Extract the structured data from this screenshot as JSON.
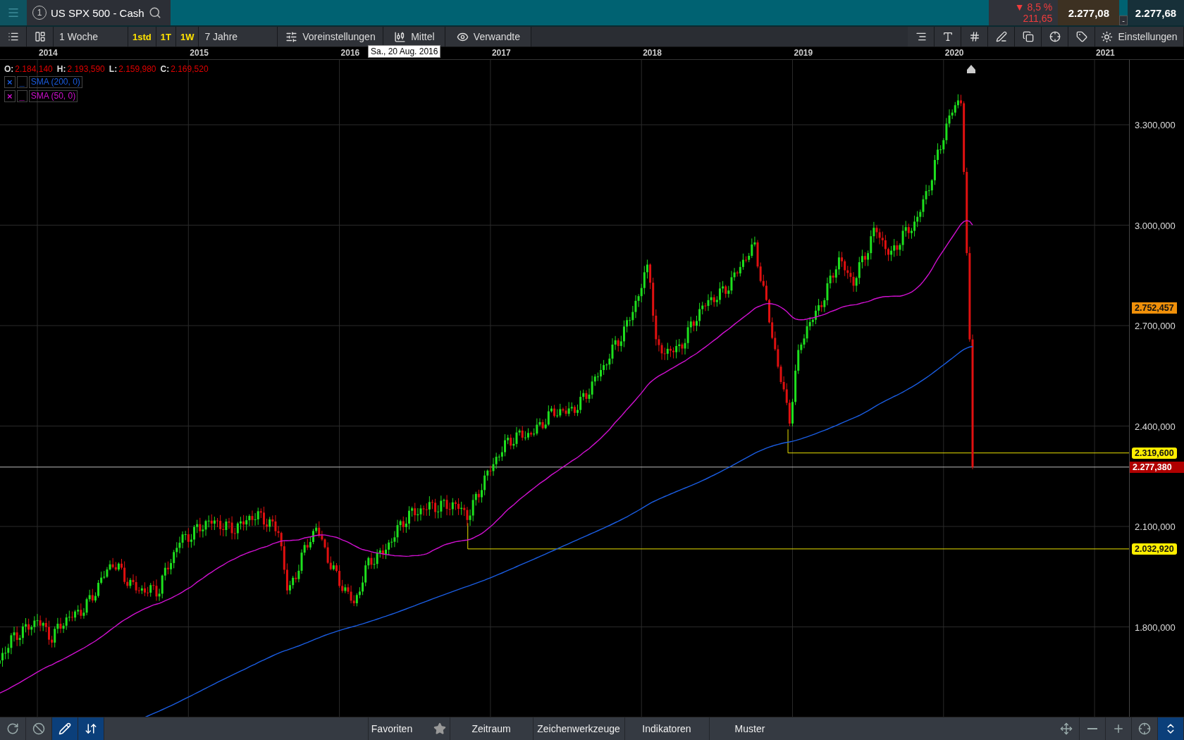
{
  "header": {
    "instrument_number": "1",
    "title": "US SPX 500 - Cash",
    "change_arrow": "▼",
    "change_percent": "8,5 %",
    "change_points": "211,65",
    "sell": "2.277,08",
    "buy": "2.277,68",
    "spread": "-"
  },
  "toolbar": {
    "interval": "1 Woche",
    "quick_intervals": [
      "1std",
      "1T",
      "1W"
    ],
    "range": "7 Jahre",
    "presets": "Voreinstellungen",
    "chart_type": "Mittel",
    "related": "Verwandte",
    "settings": "Einstellungen"
  },
  "time_axis": {
    "years": [
      "2014",
      "2015",
      "2016",
      "2017",
      "2018",
      "2019",
      "2020",
      "2021"
    ],
    "tooltip": "Sa., 20 Aug. 2016"
  },
  "ohlc": [
    {
      "label": "O:",
      "value": "2.184,140"
    },
    {
      "label": "H:",
      "value": "2.193,590"
    },
    {
      "label": "L:",
      "value": "2.159,980"
    },
    {
      "label": "C:",
      "value": "2.169,520"
    }
  ],
  "indicators": [
    {
      "remove": "×",
      "style": "_",
      "name": "SMA (200, 0)",
      "color": "#1a5ce0"
    },
    {
      "remove": "×",
      "style": "_",
      "name": "SMA (50, 0)",
      "color": "#d010d0"
    }
  ],
  "price_axis": {
    "ticks": [
      "3.300,000",
      "3.000,000",
      "2.700,000",
      "2.400,000",
      "2.100,000",
      "1.800,000"
    ],
    "markers": [
      {
        "kind": "average",
        "label": "2.752,457"
      },
      {
        "kind": "level",
        "label": "2.319,600"
      },
      {
        "kind": "current",
        "label": "2.277,380"
      },
      {
        "kind": "level",
        "label": "2.032,920"
      }
    ]
  },
  "bottom_bar": {
    "left_tools": [
      {
        "selected": false
      },
      {
        "selected": false
      },
      {
        "selected": true
      },
      {
        "selected": true
      }
    ],
    "menus": [
      {
        "label": "Favoriten",
        "starred": true
      },
      {
        "label": "Zeitraum",
        "starred": false
      },
      {
        "label": "Zeichenwerkzeuge",
        "starred": false
      },
      {
        "label": "Indikatoren",
        "starred": false
      },
      {
        "label": "Muster",
        "starred": false
      }
    ],
    "right_tools": [
      {
        "selected": false
      },
      {
        "selected": false
      },
      {
        "selected": false
      },
      {
        "selected": false
      },
      {
        "selected": true
      }
    ]
  }
}
